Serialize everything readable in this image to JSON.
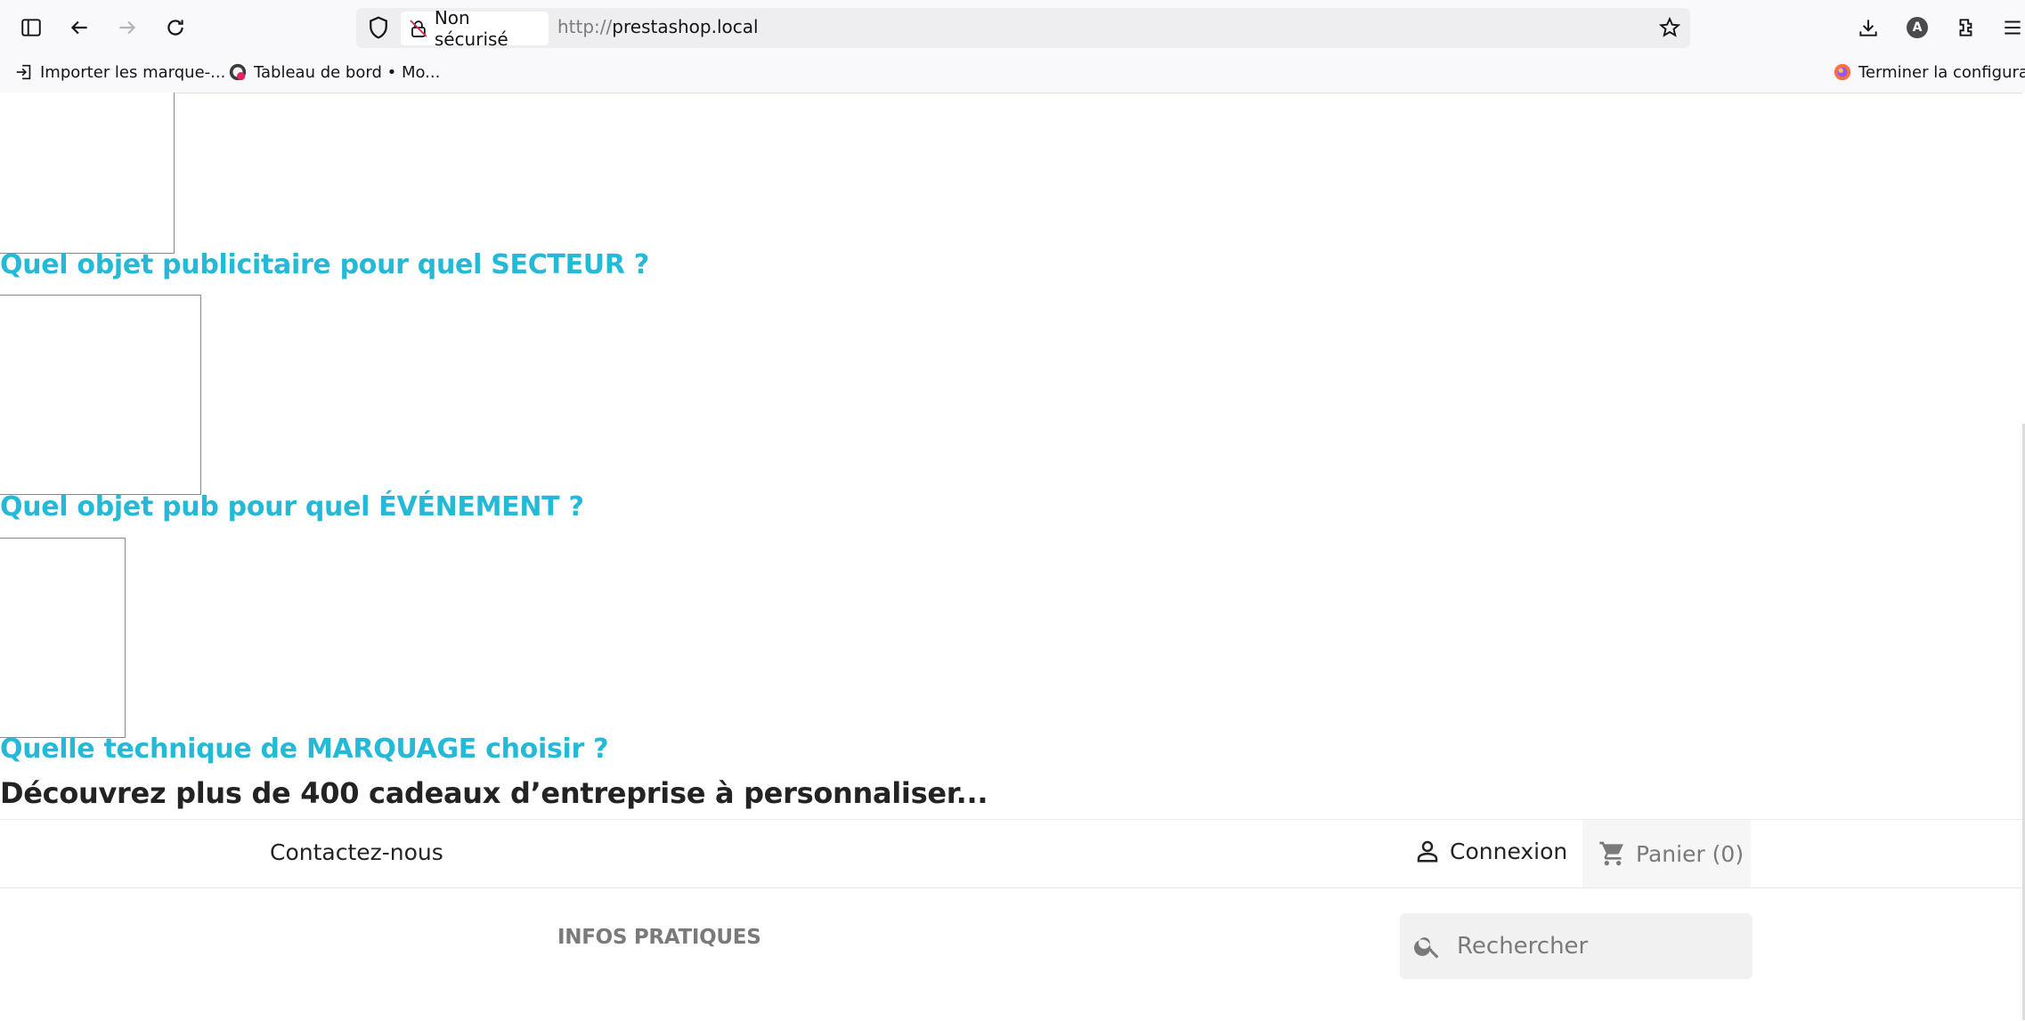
{
  "browser": {
    "security_label": "Non sécurisé",
    "url_scheme": "http://",
    "url_host": "prestashop.local",
    "bookmarks": [
      {
        "label": "Importer les marque-..."
      },
      {
        "label": "Tableau de bord • Mo..."
      },
      {
        "label": "Terminer la configurati..."
      }
    ],
    "profile_initial": "A"
  },
  "page": {
    "categories": [
      {
        "prefix": "Quel objet publicitaire pour quel ",
        "highlight": "SECTEUR",
        "suffix": " ?"
      },
      {
        "prefix": "Quel objet pub pour quel ",
        "highlight": "ÉVÉNEMENT",
        "suffix": " ?"
      },
      {
        "prefix": "Quelle technique de ",
        "highlight": "MARQUAGE",
        "suffix": " choisir ?"
      }
    ],
    "tagline": "Découvrez plus de 400 cadeaux d’entreprise à personnaliser...",
    "nav": {
      "contact_label": "Contactez-nous",
      "login_label": "Connexion",
      "cart_label": "Panier (0)"
    },
    "menu": {
      "infos_label": "INFOS PRATIQUES"
    },
    "search": {
      "placeholder": "Rechercher"
    },
    "colors": {
      "accent": "#24b9d7",
      "text": "#232323",
      "muted": "#7a7a7a"
    }
  }
}
